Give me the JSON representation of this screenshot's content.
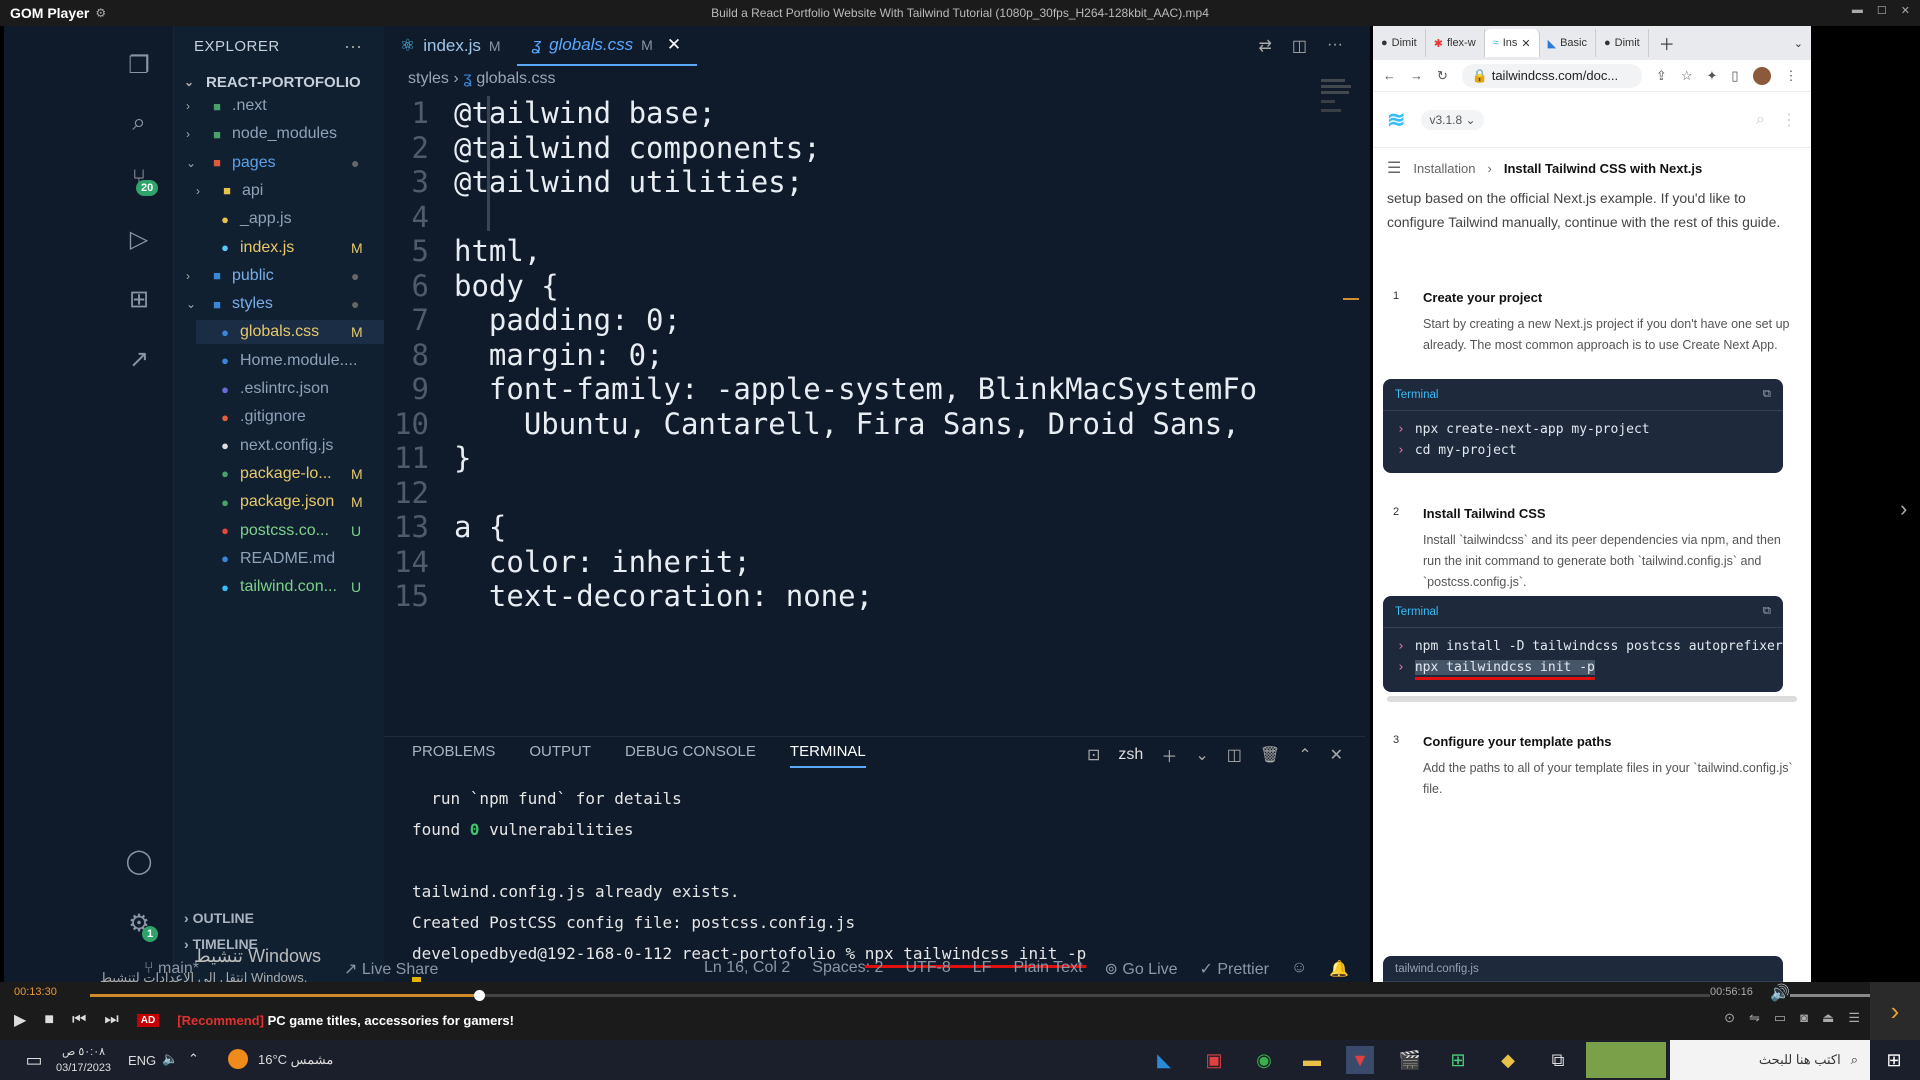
{
  "player": {
    "logo": "GOM Player",
    "title": "Build a React Portfolio Website With Tailwind Tutorial (1080p_30fps_H264-128kbit_AAC).mp4",
    "time_current": "00:13:30",
    "time_duration": "00:56:16",
    "progress_fraction": 0.24,
    "ad_badge": "AD",
    "ad_text_tag": "[Recommend]",
    "ad_text": "PC game titles, accessories for gamers!"
  },
  "vscode": {
    "explorer_title": "EXPLORER",
    "project": "REACT-PORTOFOLIO",
    "source_control_badge": "20",
    "settings_badge": "1",
    "tree": [
      {
        "label": ".next",
        "icon": "folder-icon",
        "color": "#4aa06a",
        "status": "",
        "indent": 1,
        "chev": "›"
      },
      {
        "label": "node_modules",
        "icon": "folder-icon",
        "color": "#4aa06a",
        "status": "",
        "indent": 1,
        "chev": "›"
      },
      {
        "label": "pages",
        "icon": "folder-open-icon",
        "color": "#e05a3c",
        "status": "●",
        "indent": 1,
        "chev": "⌄"
      },
      {
        "label": "api",
        "icon": "folder-icon",
        "color": "#e8c04a",
        "status": "",
        "indent": 2,
        "chev": "›"
      },
      {
        "label": "_app.js",
        "icon": "js-file-icon",
        "color": "#e8c04a",
        "status": "",
        "indent": 2,
        "chev": ""
      },
      {
        "label": "index.js",
        "icon": "react-file-icon",
        "color": "#5cc8f5",
        "status": "M",
        "indent": 2,
        "chev": ""
      },
      {
        "label": "public",
        "icon": "folder-icon",
        "color": "#3a86d8",
        "status": "●",
        "indent": 1,
        "chev": "›"
      },
      {
        "label": "styles",
        "icon": "folder-open-icon",
        "color": "#3a86d8",
        "status": "●",
        "indent": 1,
        "chev": "⌄"
      },
      {
        "label": "globals.css",
        "icon": "css-file-icon",
        "color": "#3a86d8",
        "status": "M",
        "indent": 2,
        "chev": ""
      },
      {
        "label": "Home.module....",
        "icon": "css-file-icon",
        "color": "#3a86d8",
        "status": "",
        "indent": 2,
        "chev": ""
      },
      {
        "label": ".eslintrc.json",
        "icon": "eslint-file-icon",
        "color": "#6a6ad8",
        "status": "",
        "indent": 1,
        "chev": ""
      },
      {
        "label": ".gitignore",
        "icon": "git-file-icon",
        "color": "#e0603c",
        "status": "",
        "indent": 1,
        "chev": ""
      },
      {
        "label": "next.config.js",
        "icon": "next-file-icon",
        "color": "#dddddd",
        "status": "",
        "indent": 1,
        "chev": ""
      },
      {
        "label": "package-lo...",
        "icon": "npm-file-icon",
        "color": "#4aa06a",
        "status": "M",
        "indent": 1,
        "chev": ""
      },
      {
        "label": "package.json",
        "icon": "npm-file-icon",
        "color": "#4aa06a",
        "status": "M",
        "indent": 1,
        "chev": ""
      },
      {
        "label": "postcss.co...",
        "icon": "postcss-file-icon",
        "color": "#e04a3c",
        "status": "U",
        "indent": 1,
        "chev": ""
      },
      {
        "label": "README.md",
        "icon": "info-file-icon",
        "color": "#3a86d8",
        "status": "",
        "indent": 1,
        "chev": ""
      },
      {
        "label": "tailwind.con...",
        "icon": "tailwind-file-icon",
        "color": "#38bdf8",
        "status": "U",
        "indent": 1,
        "chev": ""
      }
    ],
    "tabs": [
      {
        "label": "index.js",
        "status": "M",
        "active": false
      },
      {
        "label": "globals.css",
        "status": "M",
        "active": true
      }
    ],
    "breadcrumb": [
      "styles",
      "globals.css"
    ],
    "code": [
      {
        "n": "1",
        "t": "@tailwind base;"
      },
      {
        "n": "2",
        "t": "@tailwind components;"
      },
      {
        "n": "3",
        "t": "@tailwind utilities;"
      },
      {
        "n": "4",
        "t": ""
      },
      {
        "n": "5",
        "t": "html,"
      },
      {
        "n": "6",
        "t": "body {"
      },
      {
        "n": "7",
        "t": "  padding: 0;"
      },
      {
        "n": "8",
        "t": "  margin: 0;"
      },
      {
        "n": "9",
        "t": "  font-family: -apple-system, BlinkMacSystemFo"
      },
      {
        "n": "10",
        "t": "    Ubuntu, Cantarell, Fira Sans, Droid Sans,"
      },
      {
        "n": "11",
        "t": "}"
      },
      {
        "n": "12",
        "t": ""
      },
      {
        "n": "13",
        "t": "a {"
      },
      {
        "n": "14",
        "t": "  color: inherit;"
      },
      {
        "n": "15",
        "t": "  text-decoration: none;"
      }
    ],
    "panel_tabs": [
      "PROBLEMS",
      "OUTPUT",
      "DEBUG CONSOLE",
      "TERMINAL"
    ],
    "shell": "zsh",
    "terminal": {
      "l1": "  run `npm fund` for details",
      "l2a": "found ",
      "l2b": "0",
      "l2c": " vulnerabilities",
      "l3": "tailwind.config.js already exists.",
      "l4": "Created PostCSS config file: postcss.config.js",
      "prompt": "developedbyed@192-168-0-112 react-portofolio % ",
      "cmd": "npx tailwindcss init -p"
    },
    "outline": "OUTLINE",
    "timeline": "TIMELINE",
    "status": {
      "branch": "main*",
      "live_share": "Live Share",
      "position": "Ln 16, Col 2",
      "spaces": "Spaces: 2",
      "encoding": "UTF-8",
      "eol": "LF",
      "language": "Plain Text",
      "go_live": "Go Live",
      "prettier": "Prettier"
    },
    "windows_activation": "تنشيط Windows",
    "windows_activation_sub": "انتقل إلى الإعدادات لتنشيط Windows."
  },
  "browser": {
    "tabs": [
      "Dimit",
      "flex-w",
      "Ins",
      "Basic",
      "Dimit"
    ],
    "url": "tailwindcss.com/doc...",
    "version": "v3.1.8",
    "crumb1": "Installation",
    "crumb2": "Install Tailwind CSS with Next.js",
    "intro": "setup based on the official Next.js example. If you'd like to configure Tailwind manually, continue with the rest of this guide.",
    "steps": [
      {
        "n": "1",
        "title": "Create your project",
        "body": "Start by creating a new Next.js project if you don't have one set up already. The most common approach is to use Create Next App."
      },
      {
        "n": "2",
        "title": "Install Tailwind CSS",
        "body": "Install `tailwindcss` and its peer dependencies via npm, and then run the init command to generate both `tailwind.config.js` and `postcss.config.js`."
      },
      {
        "n": "3",
        "title": "Configure your template paths",
        "body": "Add the paths to all of your template files in your `tailwind.config.js` file."
      }
    ],
    "term_label": "Terminal",
    "term1": [
      "npx create-next-app my-project",
      "cd my-project"
    ],
    "term2": [
      "npm install -D tailwindcss postcss autoprefixer",
      "npx tailwindcss init -p"
    ],
    "file_label": "tailwind.config.js"
  },
  "taskbar": {
    "search_placeholder": "اكتب هنا للبحث",
    "weather": "16°C مشمس",
    "lang": "ENG",
    "time": "٥٠:٠٨ ص",
    "date": "03/17/2023"
  }
}
